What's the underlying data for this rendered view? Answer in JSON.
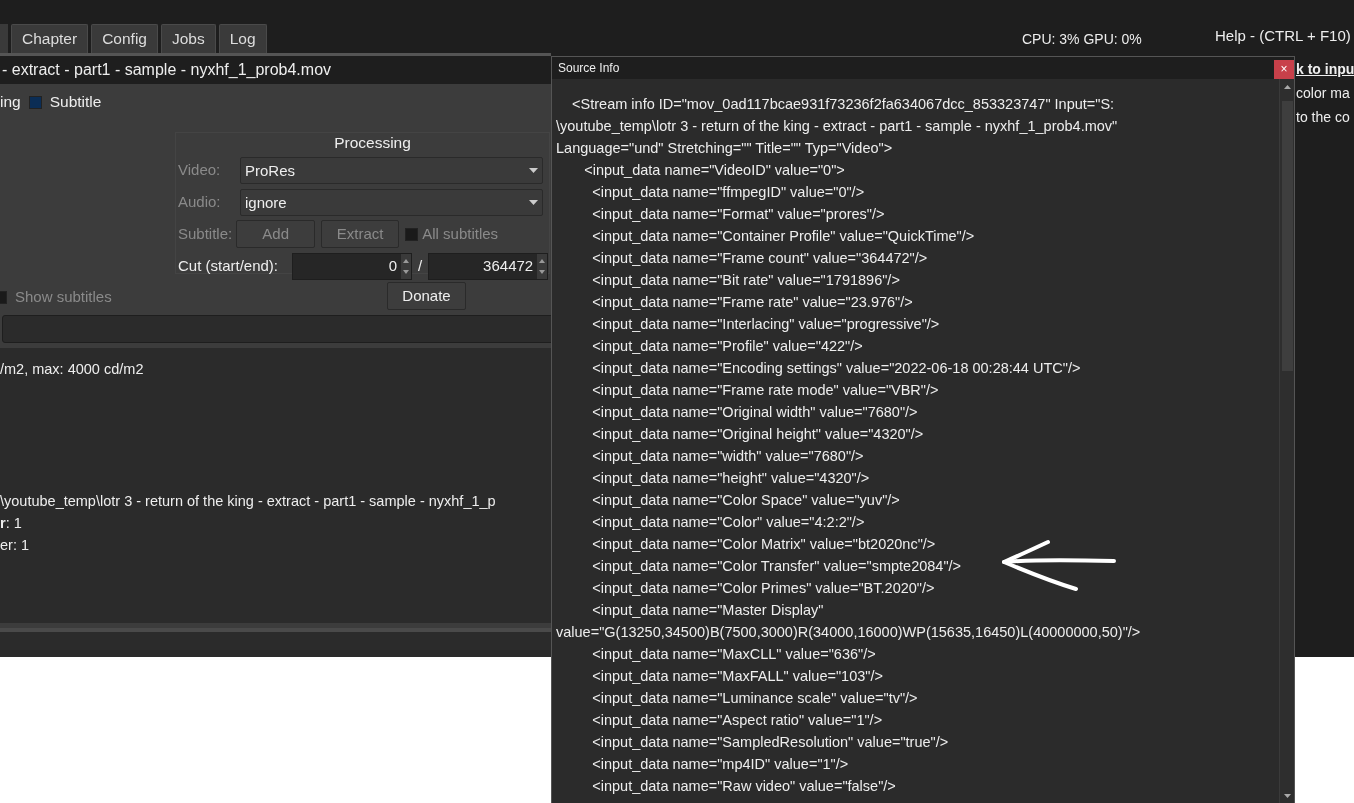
{
  "top_bar": {
    "tabs": [
      {
        "label": "Chapter",
        "selected": false
      },
      {
        "label": "Config",
        "selected": false
      },
      {
        "label": "Jobs",
        "selected": false
      },
      {
        "label": "Log",
        "selected": false
      }
    ],
    "usage": "CPU: 3% GPU: 0%",
    "help_title": "Help - (CTRL + F10)"
  },
  "main_window": {
    "title": "- extract - part1 - sample - nyxhf_1_prob4.mov",
    "partial_label": "ing",
    "subtitle_checkbox": {
      "label": "Subtitle",
      "checked": true
    },
    "processing": {
      "title": "Processing",
      "video": {
        "label": "Video:",
        "value": "ProRes"
      },
      "audio": {
        "label": "Audio:",
        "value": "ignore"
      },
      "subtitle": {
        "label": "Subtitle:",
        "buttons": [
          {
            "label": "Add",
            "disabled": true
          },
          {
            "label": "Extract",
            "disabled": true
          }
        ],
        "all_subtitles": {
          "label": "All subtitles",
          "checked": false,
          "disabled": true
        }
      },
      "cut": {
        "label": "Cut (start/end):",
        "start": "0",
        "separator": "/",
        "end": "364472"
      }
    },
    "show_subtitles": {
      "label": "Show subtitles",
      "checked": false,
      "disabled": true
    },
    "donate": "Donate",
    "log_lines_top": [
      "/m2, max: 4000 cd/m2"
    ],
    "log_lines_bottom": [
      "\\youtube_temp\\lotr 3 - return of the king - extract - part1 - sample - nyxhf_1_p",
      "**r**: 1",
      "er: 1"
    ]
  },
  "source_info": {
    "title": "Source Info",
    "close": "×",
    "lines": [
      "    <Stream info ID=\"mov_0ad117bcae931f73236f2fa634067dcc_853323747\" Input=\"S:",
      "\\youtube_temp\\lotr 3 - return of the king - extract - part1 - sample - nyxhf_1_prob4.mov\"",
      "Language=\"und\" Stretching=\"\" Title=\"\" Typ=\"Video\">",
      "       <input_data name=\"VideoID\" value=\"0\">",
      "         <input_data name=\"ffmpegID\" value=\"0\"/>",
      "         <input_data name=\"Format\" value=\"prores\"/>",
      "         <input_data name=\"Container Profile\" value=\"QuickTime\"/>",
      "         <input_data name=\"Frame count\" value=\"364472\"/>",
      "         <input_data name=\"Bit rate\" value=\"1791896\"/>",
      "         <input_data name=\"Frame rate\" value=\"23.976\"/>",
      "         <input_data name=\"Interlacing\" value=\"progressive\"/>",
      "         <input_data name=\"Profile\" value=\"422\"/>",
      "         <input_data name=\"Encoding settings\" value=\"2022-06-18 00:28:44 UTC\"/>",
      "         <input_data name=\"Frame rate mode\" value=\"VBR\"/>",
      "         <input_data name=\"Original width\" value=\"7680\"/>",
      "         <input_data name=\"Original height\" value=\"4320\"/>",
      "         <input_data name=\"width\" value=\"7680\"/>",
      "         <input_data name=\"height\" value=\"4320\"/>",
      "         <input_data name=\"Color Space\" value=\"yuv\"/>",
      "         <input_data name=\"Color\" value=\"4:2:2\"/>",
      "         <input_data name=\"Color Matrix\" value=\"bt2020nc\"/>",
      "         <input_data name=\"Color Transfer\" value=\"smpte2084\"/>",
      "         <input_data name=\"Color Primes\" value=\"BT.2020\"/>",
      "         <input_data name=\"Master Display\"",
      "value=\"G(13250,34500)B(7500,3000)R(34000,16000)WP(15635,16450)L(40000000,50)\"/>",
      "         <input_data name=\"MaxCLL\" value=\"636\"/>",
      "         <input_data name=\"MaxFALL\" value=\"103\"/>",
      "         <input_data name=\"Luminance scale\" value=\"tv\"/>",
      "         <input_data name=\"Aspect ratio\" value=\"1\"/>",
      "         <input_data name=\"SampledResolution\" value=\"true\"/>",
      "         <input_data name=\"mp4ID\" value=\"1\"/>",
      "         <input_data name=\"Raw video\" value=\"false\"/>"
    ]
  },
  "help_panel": {
    "lines": [
      {
        "text": "k to inpu",
        "kind": "link"
      },
      {
        "text": "color ma",
        "kind": "text"
      },
      {
        "text": "to the co",
        "kind": "text"
      }
    ]
  }
}
